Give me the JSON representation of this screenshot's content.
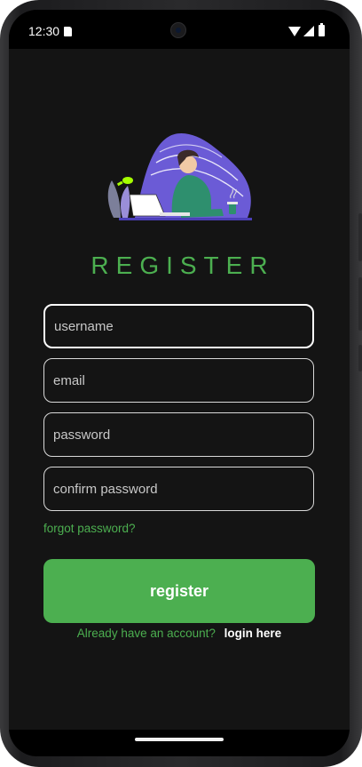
{
  "status_bar": {
    "time": "12:30",
    "icons": [
      "sd-card-icon",
      "wifi-icon",
      "signal-icon",
      "battery-icon"
    ]
  },
  "page": {
    "title": "REGISTER",
    "illustration": "person-at-laptop-illustration"
  },
  "form": {
    "username_placeholder": "username",
    "email_placeholder": "email",
    "password_placeholder": "password",
    "confirm_placeholder": "confirm password",
    "forgot_label": "forgot password?",
    "submit_label": "register",
    "login_prompt": "Already have an account?",
    "login_link": "login here"
  },
  "colors": {
    "accent": "#4caf50",
    "background": "#141414",
    "field_border": "#d9d9d9",
    "illustration_blob": "#6b5bd6"
  }
}
